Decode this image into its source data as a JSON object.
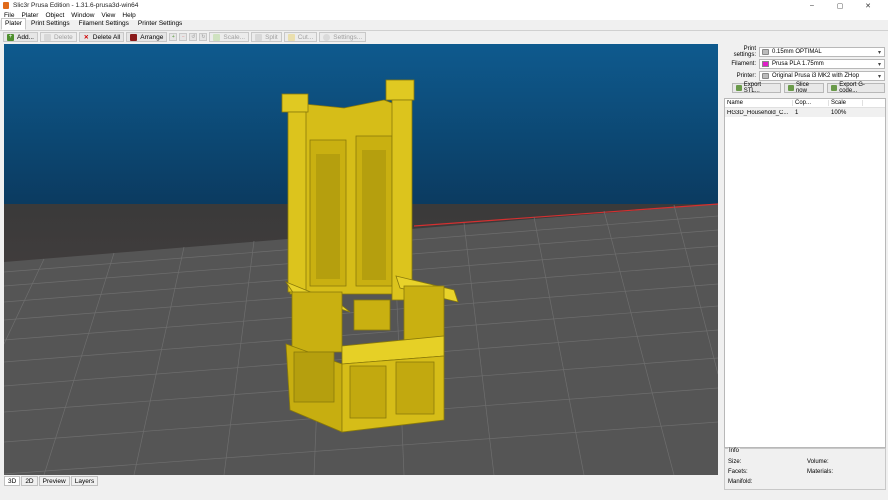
{
  "window": {
    "title": "Slic3r Prusa Edition - 1.31.6-prusa3d-win64",
    "controls": [
      "–",
      "▢",
      "✕"
    ]
  },
  "menu": [
    "File",
    "Plater",
    "Object",
    "Window",
    "View",
    "Help"
  ],
  "tabs": [
    "Plater",
    "Print Settings",
    "Filament Settings",
    "Printer Settings"
  ],
  "toolbar": {
    "add": "Add...",
    "delete": "Delete",
    "delete_all": "Delete All",
    "arrange": "Arrange",
    "scale": "Scale...",
    "split": "Split",
    "cut": "Cut...",
    "settings": "Settings..."
  },
  "view_tabs": [
    "3D",
    "2D",
    "Preview",
    "Layers"
  ],
  "settings": {
    "print_label": "Print settings:",
    "print_value": "0.15mm OPTIMAL",
    "filament_label": "Filament:",
    "filament_value": "Prusa PLA 1.75mm",
    "filament_color": "#e020c8",
    "printer_label": "Printer:",
    "printer_value": "Original Prusa i3 MK2 with ZHop"
  },
  "export": {
    "stl": "Export STL...",
    "slice": "Slice now",
    "gcode": "Export G-code..."
  },
  "object_list": {
    "headers": [
      "Name",
      "Cop...",
      "Scale"
    ],
    "rows": [
      [
        "HG3D_Household_C...",
        "1",
        "100%"
      ]
    ]
  },
  "info": {
    "title": "Info",
    "size": "Size:",
    "volume": "Volume:",
    "facets": "Facets:",
    "materials": "Materials:",
    "manifold": "Manifold:"
  },
  "colors": {
    "model": "#d9c21c",
    "bed_grid": "#5a5a5a",
    "sky_top": "#0e5a8e",
    "bed_edge": "#d43030"
  }
}
